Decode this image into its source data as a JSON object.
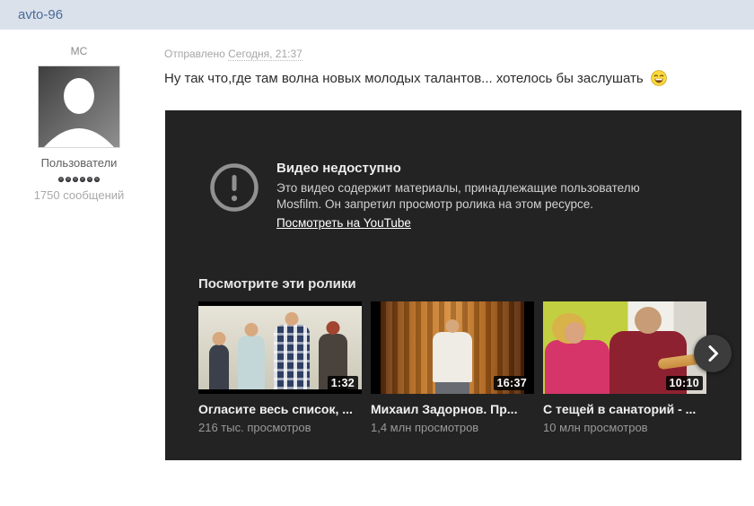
{
  "header": {
    "username": "avto-96"
  },
  "user_panel": {
    "member_title": "МС",
    "avatar_icon": "person-silhouette-icon",
    "group": "Пользователи",
    "reputation_pips": 6,
    "posts": "1750 сообщений"
  },
  "post": {
    "sent_label": "Отправлено",
    "sent_time": "Сегодня, 21:37",
    "message": "Ну так что,где там волна новых молодых талантов... хотелось бы заслушать",
    "emoji_icon": "laughing-smiley-icon"
  },
  "player": {
    "error_icon": "exclamation-circle-icon",
    "error_title": "Видео недоступно",
    "error_lines": [
      "Это видео содержит материалы, принадлежащие пользователю",
      "Mosfilm. Он запретил просмотр ролика на этом ресурсе."
    ],
    "watch_link": "Посмотреть на YouTube",
    "suggestions_title": "Посмотрите эти ролики",
    "next_icon": "chevron-right-icon",
    "videos": [
      {
        "title": "Огласите весь список, ...",
        "views": "216 тыс. просмотров",
        "duration": "1:32"
      },
      {
        "title": "Михаил Задорнов. Пр...",
        "views": "1,4 млн просмотров",
        "duration": "16:37"
      },
      {
        "title": "С тещей в санаторий - ...",
        "views": "10 млн просмотров",
        "duration": "10:10"
      }
    ]
  },
  "colors": {
    "header_bg": "#dbe1eb",
    "username_link": "#4a6b99",
    "player_bg": "#232323",
    "error_text": "#d2d2d2",
    "views_text": "#999999",
    "title_text": "#f1f1f1"
  }
}
